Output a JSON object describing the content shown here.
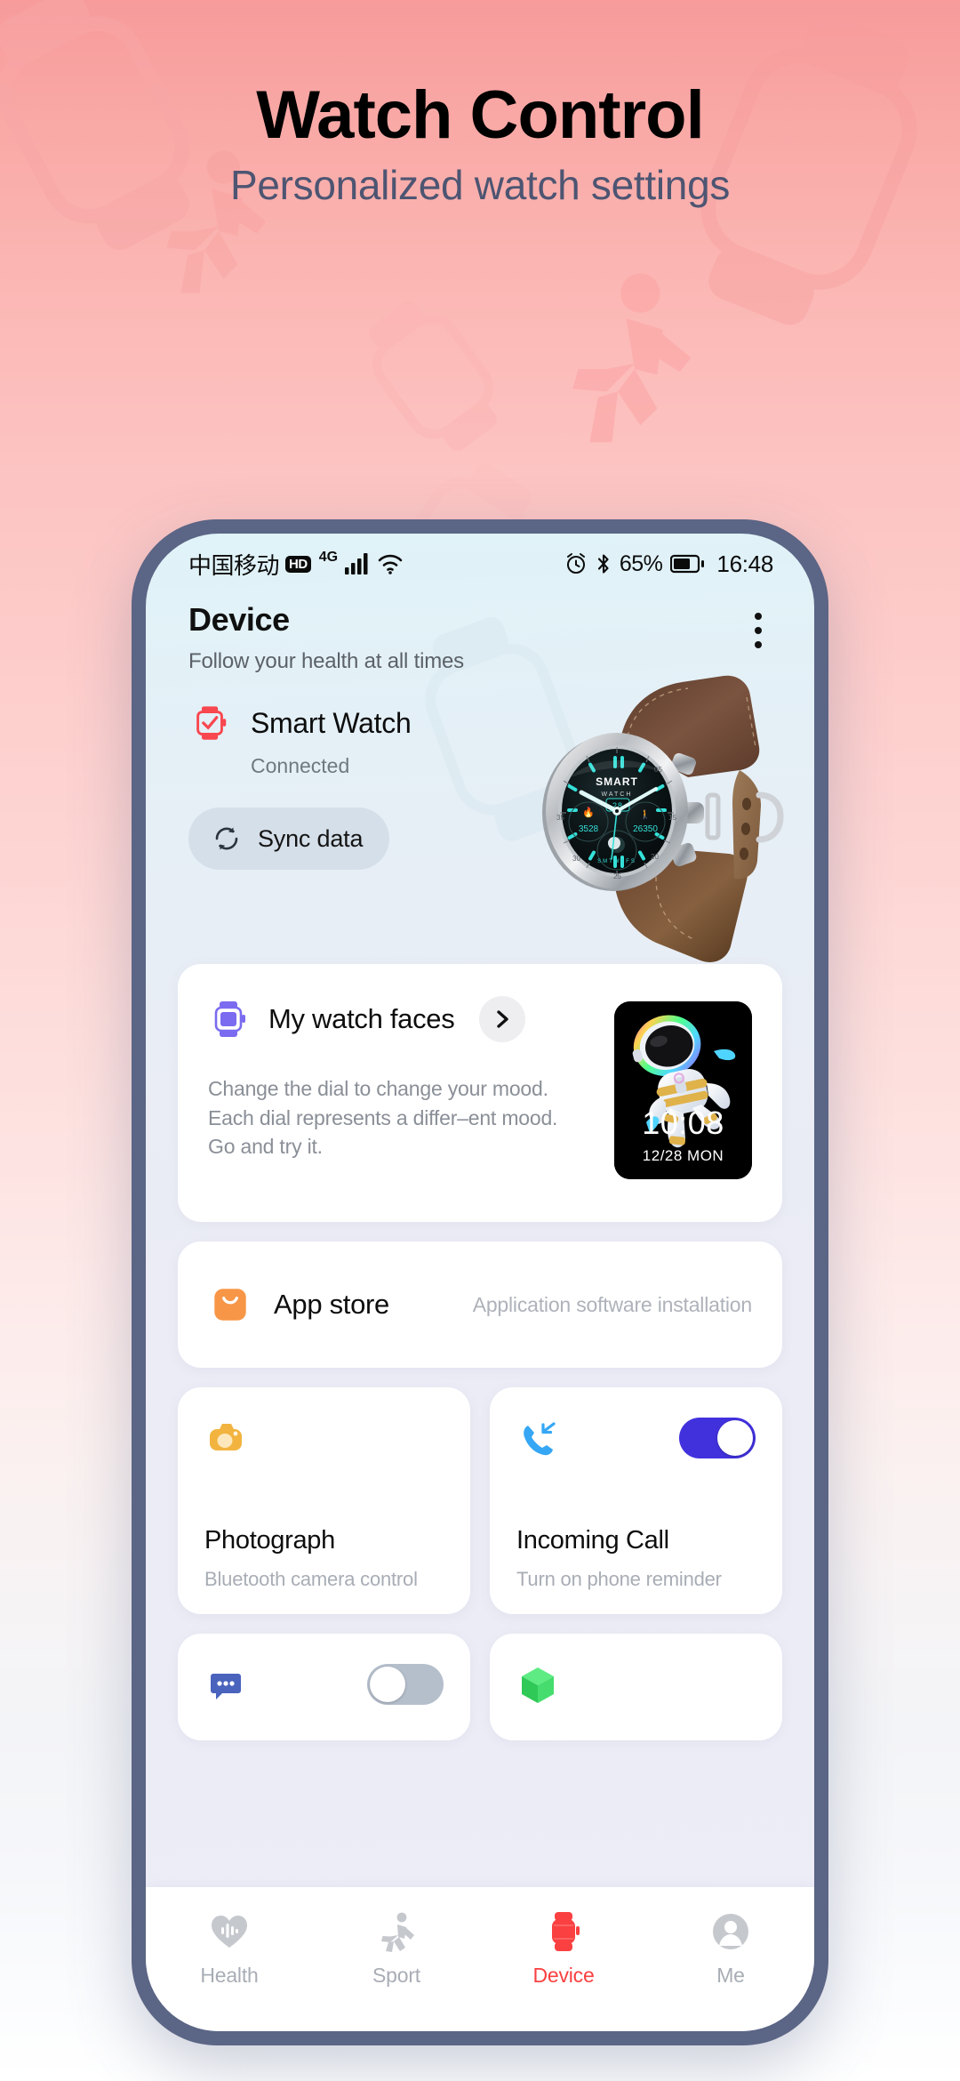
{
  "promo": {
    "title": "Watch Control",
    "subtitle": "Personalized watch settings",
    "title_color": "#000000",
    "subtitle_color": "#4d5572",
    "bg_top_color": "#f79b9b",
    "bg_bottom_color": "#ffffff"
  },
  "status_bar": {
    "carrier": "中国移动",
    "hd_badge": "HD",
    "network_type": "4G",
    "signal_icon": "signal-bars-icon",
    "wifi_icon": "wifi-icon",
    "alarm_icon": "alarm-clock-icon",
    "bluetooth_icon": "bluetooth-icon",
    "battery_percent": "65%",
    "battery_icon": "battery-icon",
    "clock": "16:48"
  },
  "header": {
    "title": "Device",
    "subtitle": "Follow your health at all times",
    "overflow_icon": "more-vertical-icon"
  },
  "device": {
    "icon": "watch-check-icon",
    "icon_color": "#f8474f",
    "name": "Smart Watch",
    "status": "Connected",
    "sync_button_label": "Sync data",
    "sync_icon": "sync-refresh-icon",
    "sync_button_bg": "#d5dfe9",
    "watch_image": "smart-watch-product-photo",
    "watch_dial_brand": "SMART",
    "watch_dial_brand_sub": "WATCH",
    "watch_dial_date": "28",
    "watch_dial_left_value": "3528",
    "watch_dial_right_value": "26350",
    "watch_dial_accent": "#35e0d8",
    "watch_strap_color": "#6b4a36"
  },
  "watch_faces": {
    "icon": "watch-face-icon",
    "icon_color": "#7a6bf0",
    "title": "My watch faces",
    "chevron_icon": "chevron-right-icon",
    "description": "Change the dial to change your mood. Each dial represents a differ–ent mood. Go and try it.",
    "preview": {
      "name": "astronaut-watch-face",
      "time": "10:08",
      "date": "12/28  MON",
      "bg_color": "#000000"
    }
  },
  "app_store": {
    "icon": "shopping-bag-icon",
    "icon_color": "#f79647",
    "title": "App store",
    "subtitle": "Application software installation"
  },
  "tiles": [
    {
      "name": "photograph",
      "icon": "camera-icon",
      "icon_color": "#f2b43f",
      "title": "Photograph",
      "subtitle": "Bluetooth camera control",
      "has_switch": false
    },
    {
      "name": "incoming-call",
      "icon": "incoming-call-icon",
      "icon_color": "#35a7f5",
      "title": "Incoming Call",
      "subtitle": "Turn on phone reminder",
      "has_switch": true,
      "switch_on": true,
      "switch_on_color": "#4131dd"
    }
  ],
  "tiles_partial": [
    {
      "name": "message",
      "icon": "message-bubble-icon",
      "icon_color": "#4a63bd",
      "has_switch": true,
      "switch_on": false,
      "switch_off_color": "#b5bfcc"
    },
    {
      "name": "cube-app",
      "icon": "green-cube-icon",
      "icon_color": "#3ddb63",
      "has_switch": false
    }
  ],
  "bottom_nav": {
    "active_color": "#fa4040",
    "inactive_color": "#a8adb5",
    "items": [
      {
        "label": "Health",
        "icon": "heart-pulse-icon",
        "active": false
      },
      {
        "label": "Sport",
        "icon": "running-person-icon",
        "active": false
      },
      {
        "label": "Device",
        "icon": "watch-icon",
        "active": true
      },
      {
        "label": "Me",
        "icon": "user-avatar-icon",
        "active": false
      }
    ]
  }
}
